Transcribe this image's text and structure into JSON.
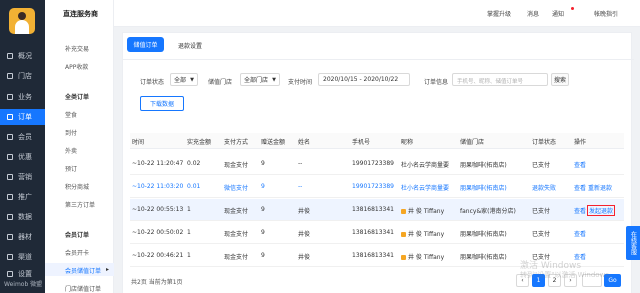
{
  "rail": {
    "brand": "Weimob 微盟",
    "items": [
      "概况",
      "门店",
      "业务",
      "订单",
      "会员",
      "优惠",
      "营销",
      "推广",
      "数据",
      "器材",
      "渠道",
      "设置"
    ]
  },
  "sidebar": {
    "shop_name": "直连服务商",
    "items": [
      "补充交易",
      "APP收款",
      "全类订单",
      "堂食",
      "到付",
      "外卖",
      "预订",
      "积分商城",
      "第三方订单",
      "会员订单",
      "会员开卡",
      "会员储值订单",
      "门店储值订单"
    ]
  },
  "topbar": {
    "items": [
      "掌握升级",
      "消息",
      "通知",
      "帐晚指引"
    ]
  },
  "tabs": {
    "active": "储值订单",
    "other": "退款设置"
  },
  "filters": {
    "status_label": "订单状态",
    "status_value": "全部",
    "store_label": "储值门店",
    "store_value": "全部门店",
    "time_label": "支付时间",
    "date_range": "2020/10/15 - 2020/10/22",
    "info_label": "订单信息",
    "search_placeholder": "手机号、昵称、储值订单号",
    "search_button": "搜索",
    "download_button": "下载数据"
  },
  "table": {
    "headers": [
      "时间",
      "实充金额",
      "支付方式",
      "赠送金额",
      "姓名",
      "手机号",
      "昵称",
      "储值门店",
      "订单状态",
      "操作"
    ],
    "rows": [
      {
        "time": "~10-22 11:20:47",
        "amount": "0.02",
        "pay": "现金支付",
        "gift": "9",
        "name": "--",
        "phone": "19901723389",
        "nick": "杜小名云学商量要",
        "store": "朋果咖啡(拓南店)",
        "status": "已支付",
        "op1": "查看",
        "op2": "",
        "blue": false
      },
      {
        "time": "~10-22 11:03:20",
        "amount": "0.01",
        "pay": "微信支付",
        "gift": "9",
        "name": "--",
        "phone": "19901723389",
        "nick": "杜小名云学商量要",
        "store": "朋果咖啡(拓南店)",
        "status": "退款失败",
        "op1": "查看",
        "op2": "重新退款",
        "blue": true
      },
      {
        "time": "~10-22 00:55:13",
        "amount": "1",
        "pay": "现金支付",
        "gift": "9",
        "name": "井俊",
        "phone": "13816813341",
        "nick": "井 俊 Tiffany",
        "store": "fancy&家(港南分店)",
        "status": "已支付",
        "op1": "查看",
        "op2": "发起退款",
        "blue": false
      },
      {
        "time": "~10-22 00:50:02",
        "amount": "1",
        "pay": "现金支付",
        "gift": "9",
        "name": "井俊",
        "phone": "13816813341",
        "nick": "井 俊 Tiffany",
        "store": "朋果咖啡(拓南店)",
        "status": "已支付",
        "op1": "查看",
        "op2": "",
        "blue": false
      },
      {
        "time": "~10-22 00:46:21",
        "amount": "1",
        "pay": "现金支付",
        "gift": "9",
        "name": "井俊",
        "phone": "13816813341",
        "nick": "井 俊 Tiffany",
        "store": "朋果咖啡(拓南店)",
        "status": "已支付",
        "op1": "查看",
        "op2": "",
        "blue": false
      }
    ]
  },
  "footer": {
    "summary": "共2页 当前为第1页",
    "prev": "‹",
    "page1": "1",
    "page2": "2",
    "next": "›",
    "go": "Go"
  },
  "float_help": "在线客服",
  "watermark": {
    "line1": "激活 Windows",
    "line2": "转到\"设置\"以激活 Windows。"
  },
  "colors": {
    "primary": "#1677ff",
    "rail_bg": "#1f2937",
    "danger": "#f5222d"
  }
}
